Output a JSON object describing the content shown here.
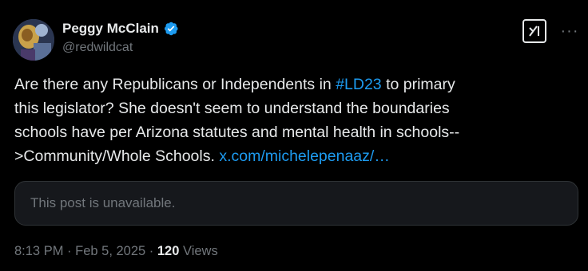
{
  "author": {
    "display_name": "Peggy McClain",
    "handle": "@redwildcat",
    "verified": true,
    "verified_color": "#1d9bf0"
  },
  "actions": {
    "grok_icon": "grok-icon",
    "more_label": "···"
  },
  "tweet": {
    "text_part1": "Are there any Republicans or Independents in ",
    "hashtag": "#LD23",
    "text_part2": " to primary this legislator?  She doesn't seem to understand the boundaries schools have per Arizona statutes and mental health in schools-->Community/Whole Schools. ",
    "link_text": "x.com/michelepenaaz/…",
    "accent_color": "#1d9bf0"
  },
  "quote": {
    "unavailable_text": "This post is unavailable."
  },
  "meta": {
    "time": "8:13 PM",
    "separator1": " · ",
    "date": "Feb 5, 2025",
    "separator2": " · ",
    "views_count": "120",
    "views_label": " Views"
  }
}
